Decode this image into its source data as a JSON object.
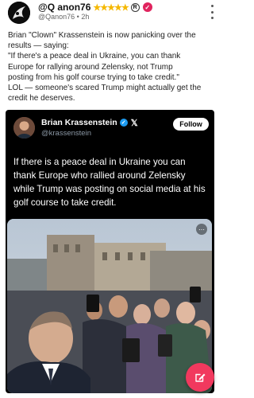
{
  "post": {
    "author": "@Q anon76",
    "stars": "★★★★★",
    "registered_mark": "R",
    "verified_mark": "✓",
    "handle_time": "@Qanon76 • 2h",
    "body": "Brian \"Clown\" Krassenstein is now panicking over the\nresults — saying:\n\"If there's a peace deal in Ukraine, you can thank\nEurope for rallying around Zelensky, not Trump\nposting from his golf course trying to take credit.\"\nLOL — someone's scared Trump might actually get the\ncredit he deserves."
  },
  "embed": {
    "name": "Brian Krassenstein",
    "verified_mark": "✓",
    "x_logo": "𝕏",
    "handle": "@krassenstein",
    "follow_label": "Follow",
    "text": "If there is a peace deal in Ukraine you can thank Europe who rallied around Zelensky while Trump was posting on social media at his golf course to take credit.",
    "video_menu_glyph": "⋯"
  },
  "colors": {
    "stars": "#f5b800",
    "verified_pink": "#e0245e",
    "blue_check": "#1d9bf0",
    "fab": "#f1395e",
    "embed_bg": "#000000"
  },
  "icons": {
    "kebab": "more-vertical-icon",
    "fab": "compose-icon"
  }
}
